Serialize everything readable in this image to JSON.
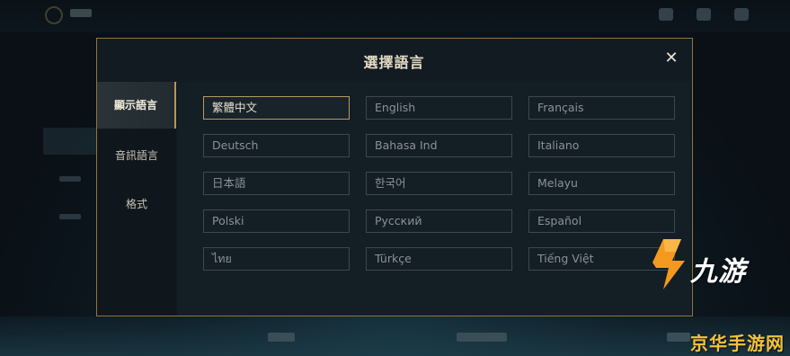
{
  "dialog": {
    "title": "選擇語言",
    "close_icon": "close-icon"
  },
  "sidebar": {
    "tabs": [
      {
        "label": "顯示語言",
        "active": true
      },
      {
        "label": "音訊語言",
        "active": false
      },
      {
        "label": "格式",
        "active": false
      }
    ]
  },
  "languages": [
    {
      "label": "繁體中文",
      "selected": true
    },
    {
      "label": "English"
    },
    {
      "label": "Français"
    },
    {
      "label": "Deutsch"
    },
    {
      "label": "Bahasa Ind"
    },
    {
      "label": "Italiano"
    },
    {
      "label": "日本語"
    },
    {
      "label": "한국어"
    },
    {
      "label": "Melayu"
    },
    {
      "label": "Polski"
    },
    {
      "label": "Русский"
    },
    {
      "label": "Español"
    },
    {
      "label": "ไทย"
    },
    {
      "label": "Türkçe"
    },
    {
      "label": "Tiếng Việt"
    }
  ],
  "watermark": {
    "brand": "九游",
    "site": "京华手游网"
  },
  "colors": {
    "accent_gold": "#b59a63",
    "watermark_orange": "#f39a1e",
    "watermark_yellow": "#f3c23e"
  }
}
